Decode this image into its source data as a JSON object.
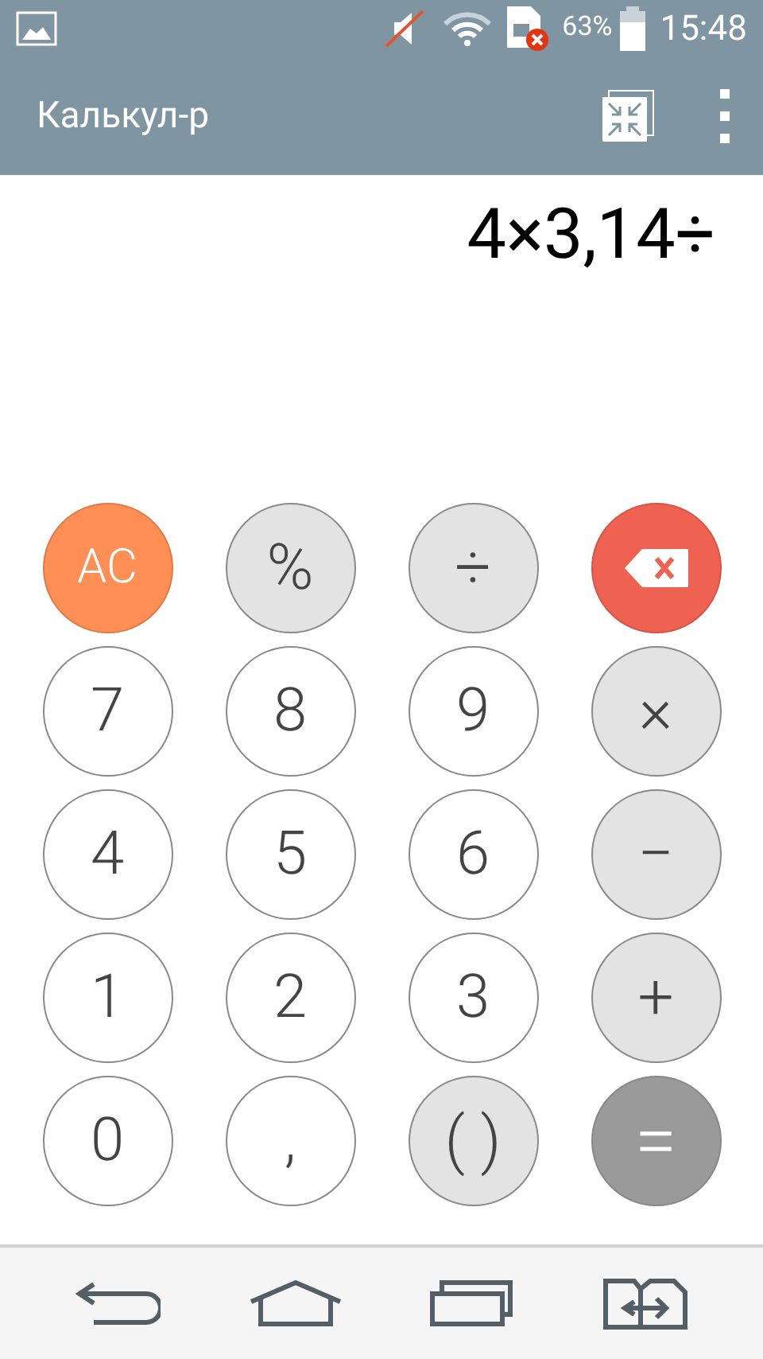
{
  "status_bar": {
    "battery": "63%",
    "time": "15:48"
  },
  "app_bar": {
    "title": "Калькул-р"
  },
  "display": {
    "expression": "4×3,14÷"
  },
  "keys": [
    {
      "kind": "clear",
      "label": "AC"
    },
    {
      "kind": "op",
      "label": "%"
    },
    {
      "kind": "op",
      "label": "÷"
    },
    {
      "kind": "back"
    },
    {
      "kind": "digit",
      "label": "7"
    },
    {
      "kind": "digit",
      "label": "8"
    },
    {
      "kind": "digit",
      "label": "9"
    },
    {
      "kind": "op",
      "label": "×"
    },
    {
      "kind": "digit",
      "label": "4"
    },
    {
      "kind": "digit",
      "label": "5"
    },
    {
      "kind": "digit",
      "label": "6"
    },
    {
      "kind": "op",
      "label": "−"
    },
    {
      "kind": "digit",
      "label": "1"
    },
    {
      "kind": "digit",
      "label": "2"
    },
    {
      "kind": "digit",
      "label": "3"
    },
    {
      "kind": "op",
      "label": "+"
    },
    {
      "kind": "digit",
      "label": "0"
    },
    {
      "kind": "digit",
      "label": ","
    },
    {
      "kind": "op",
      "label": "( )"
    },
    {
      "kind": "equals",
      "label": "="
    }
  ]
}
